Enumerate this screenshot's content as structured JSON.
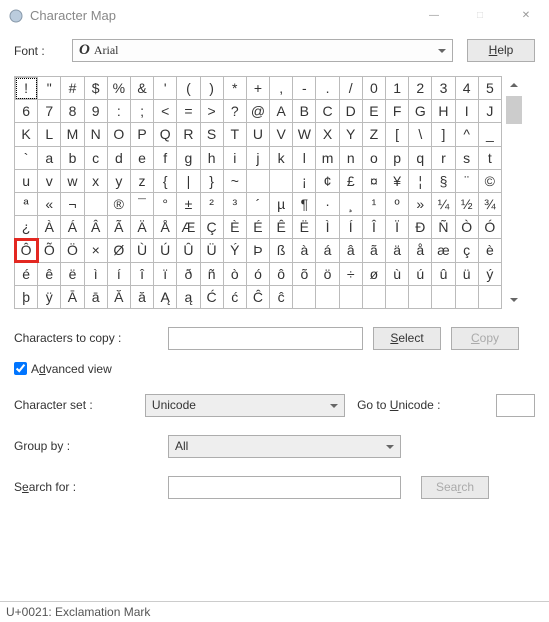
{
  "window": {
    "title": "Character Map"
  },
  "font": {
    "label": "Font :",
    "selected": "Arial",
    "help": "Help",
    "help_key": "H"
  },
  "grid": {
    "cols": 21,
    "selected_index": 0,
    "highlight_index": 147,
    "chars": [
      "!",
      "\"",
      "#",
      "$",
      "%",
      "&",
      "'",
      "(",
      ")",
      "*",
      "+",
      ",",
      "-",
      ".",
      "/",
      "0",
      "1",
      "2",
      "3",
      "4",
      "5",
      "6",
      "7",
      "8",
      "9",
      ":",
      ";",
      "<",
      "=",
      ">",
      "?",
      "@",
      "A",
      "B",
      "C",
      "D",
      "E",
      "F",
      "G",
      "H",
      "I",
      "J",
      "K",
      "L",
      "M",
      "N",
      "O",
      "P",
      "Q",
      "R",
      "S",
      "T",
      "U",
      "V",
      "W",
      "X",
      "Y",
      "Z",
      "[",
      "\\",
      "]",
      "^",
      "_",
      "`",
      "a",
      "b",
      "c",
      "d",
      "e",
      "f",
      "g",
      "h",
      "i",
      "j",
      "k",
      "l",
      "m",
      "n",
      "o",
      "p",
      "q",
      "r",
      "s",
      "t",
      "u",
      "v",
      "w",
      "x",
      "y",
      "z",
      "{",
      "|",
      "}",
      "~",
      "",
      "",
      "¡",
      "¢",
      "£",
      "¤",
      "¥",
      "¦",
      "§",
      "¨",
      "©",
      "ª",
      "«",
      "¬",
      "­",
      "®",
      "¯",
      "°",
      "±",
      "²",
      "³",
      "´",
      "µ",
      "¶",
      "·",
      "¸",
      "¹",
      "º",
      "»",
      "¼",
      "½",
      "¾",
      "¿",
      "À",
      "Á",
      "Â",
      "Ã",
      "Ä",
      "Å",
      "Æ",
      "Ç",
      "È",
      "É",
      "Ê",
      "Ë",
      "Ì",
      "Í",
      "Î",
      "Ï",
      "Ð",
      "Ñ",
      "Ò",
      "Ó",
      "Ô",
      "Õ",
      "Ö",
      "×",
      "Ø",
      "Ù",
      "Ú",
      "Û",
      "Ü",
      "Ý",
      "Þ",
      "ß",
      "à",
      "á",
      "â",
      "ã",
      "ä",
      "å",
      "æ",
      "ç",
      "è",
      "é",
      "ê",
      "ë",
      "ì",
      "í",
      "î",
      "ï",
      "ð",
      "ñ",
      "ò",
      "ó",
      "ô",
      "õ",
      "ö",
      "÷",
      "ø",
      "ù",
      "ú",
      "û",
      "ü",
      "ý",
      "þ",
      "ÿ",
      "Ā",
      "ā",
      "Ă",
      "ă",
      "Ą",
      "ą",
      "Ć",
      "ć",
      "Ĉ",
      "ĉ"
    ]
  },
  "copy": {
    "label": "Characters to copy :",
    "value": "",
    "select_label": "Select",
    "select_key": "S",
    "copy_label": "Copy",
    "copy_key": "C"
  },
  "advanced": {
    "checked": true,
    "label": "Advanced view",
    "key": "d"
  },
  "charset": {
    "label": "Character set :",
    "value": "Unicode",
    "goto_label": "Go to Unicode :",
    "goto_key": "U",
    "goto_value": ""
  },
  "groupby": {
    "label": "Group by :",
    "value": "All"
  },
  "search": {
    "label": "Search for :",
    "key": "e",
    "value": "",
    "button": "Search",
    "button_key": "r"
  },
  "status": {
    "text": "U+0021: Exclamation Mark"
  }
}
